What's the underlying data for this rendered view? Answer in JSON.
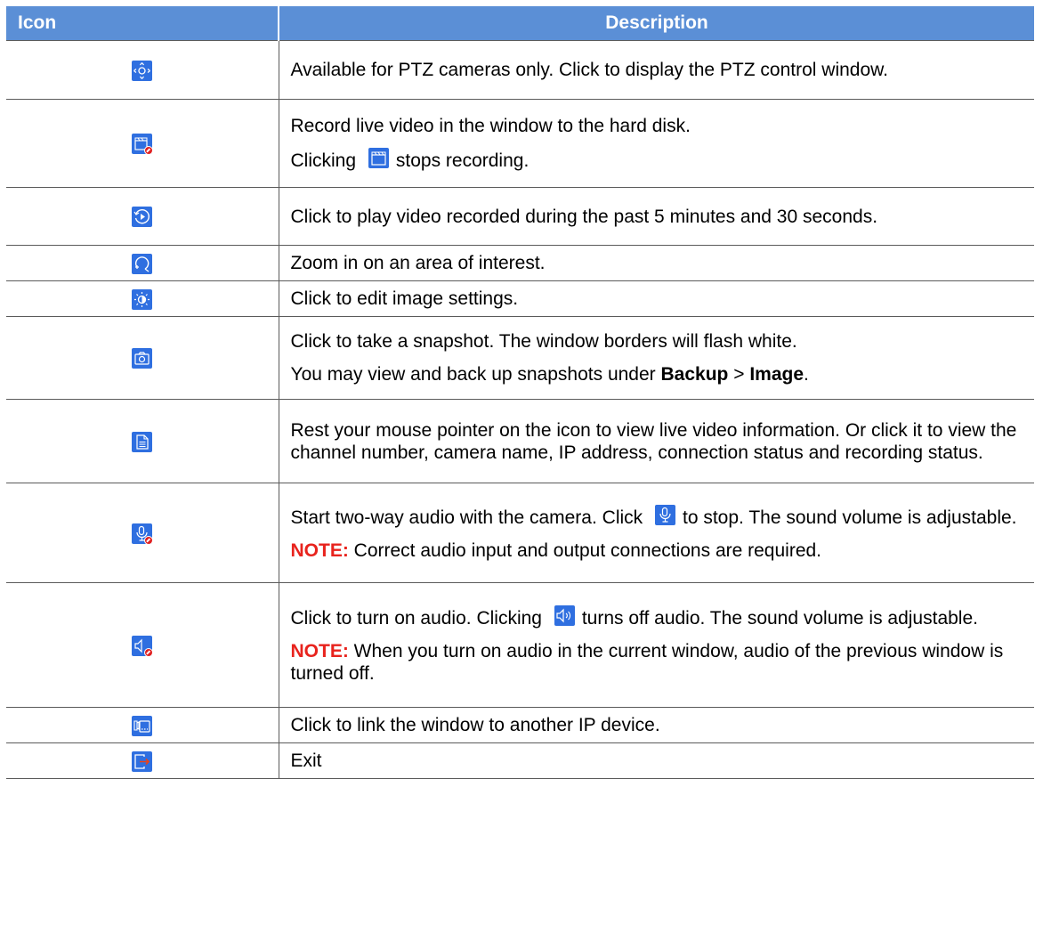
{
  "header": {
    "icon": "Icon",
    "description": "Description"
  },
  "rows": [
    {
      "icon": "ptz-icon",
      "text": "Available for PTZ cameras only. Click to display the PTZ control window."
    },
    {
      "icon": "record-stopped-icon",
      "text1": "Record live video in the window to the hard disk.",
      "text2_pre": "Clicking",
      "text2_icon": "record-icon",
      "text2_post": "stops recording."
    },
    {
      "icon": "instant-playback-icon",
      "text": "Click to play video recorded during the past 5 minutes and 30 seconds."
    },
    {
      "icon": "zoom-in-icon",
      "text": "Zoom in on an area of interest."
    },
    {
      "icon": "image-settings-icon",
      "text": "Click to edit image settings."
    },
    {
      "icon": "snapshot-icon",
      "text1": "Click to take a snapshot. The window borders will flash white.",
      "text2_pre": "You may view and back up snapshots under",
      "text2_b1": "Backup",
      "text2_sep": ">",
      "text2_b2": "Image",
      "text2_end": "."
    },
    {
      "icon": "info-icon",
      "text": "Rest your mouse pointer on the icon to view live video information. Or click it to view the channel number, camera name, IP address, connection status and recording status."
    },
    {
      "icon": "two-way-audio-off-icon",
      "text1_pre": "Start two-way audio with the camera. Click",
      "text1_icon": "microphone-icon",
      "text1_post": "to stop. The sound volume is adjustable.",
      "note_label": "NOTE:",
      "note_text": "Correct audio input and output connections are required."
    },
    {
      "icon": "audio-off-icon",
      "text1_pre": "Click to turn on audio. Clicking",
      "text1_icon": "speaker-icon",
      "text1_post": "turns off audio. The sound volume is adjustable.",
      "note_label": "NOTE:",
      "note_text": "When you turn on audio in the current window, audio of the previous window is turned off."
    },
    {
      "icon": "link-ip-device-icon",
      "text": "Click to link the window to another IP device."
    },
    {
      "icon": "exit-icon",
      "text": "Exit"
    }
  ],
  "colors": {
    "header_bg": "#5b8fd6",
    "icon_bg": "#2f6fe0",
    "note": "#e8231d",
    "badge": "#e02020",
    "exit_arrow": "#e8431d"
  }
}
